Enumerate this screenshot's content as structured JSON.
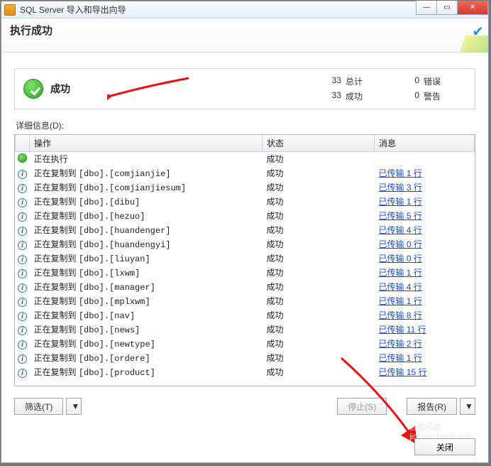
{
  "window": {
    "title": "SQL Server 导入和导出向导"
  },
  "header": {
    "title": "执行成功"
  },
  "summary": {
    "success_label": "成功",
    "total_value": "33",
    "total_label": "总计",
    "error_value": "0",
    "error_label": "错误",
    "success_value": "33",
    "success_label2": "成功",
    "warn_value": "0",
    "warn_label": "警告"
  },
  "details_label": "详细信息(D):",
  "columns": {
    "op": "操作",
    "status": "状态",
    "msg": "消息"
  },
  "rows": [
    {
      "icon": "exec",
      "op": "正在执行",
      "status": "成功",
      "msg": ""
    },
    {
      "icon": "info",
      "op": "正在复制到 [dbo].[comjianjie]",
      "status": "成功",
      "msg": "已传输 1 行"
    },
    {
      "icon": "info",
      "op": "正在复制到 [dbo].[comjianjiesum]",
      "status": "成功",
      "msg": "已传输 3 行"
    },
    {
      "icon": "info",
      "op": "正在复制到 [dbo].[dibu]",
      "status": "成功",
      "msg": "已传输 1 行"
    },
    {
      "icon": "info",
      "op": "正在复制到 [dbo].[hezuo]",
      "status": "成功",
      "msg": "已传输 5 行"
    },
    {
      "icon": "info",
      "op": "正在复制到 [dbo].[huandenger]",
      "status": "成功",
      "msg": "已传输 4 行"
    },
    {
      "icon": "info",
      "op": "正在复制到 [dbo].[huandengyi]",
      "status": "成功",
      "msg": "已传输 0 行"
    },
    {
      "icon": "info",
      "op": "正在复制到 [dbo].[liuyan]",
      "status": "成功",
      "msg": "已传输 0 行"
    },
    {
      "icon": "info",
      "op": "正在复制到 [dbo].[lxwm]",
      "status": "成功",
      "msg": "已传输 1 行"
    },
    {
      "icon": "info",
      "op": "正在复制到 [dbo].[manager]",
      "status": "成功",
      "msg": "已传输 4 行"
    },
    {
      "icon": "info",
      "op": "正在复制到 [dbo].[mplxwm]",
      "status": "成功",
      "msg": "已传输 1 行"
    },
    {
      "icon": "info",
      "op": "正在复制到 [dbo].[nav]",
      "status": "成功",
      "msg": "已传输 8 行"
    },
    {
      "icon": "info",
      "op": "正在复制到 [dbo].[news]",
      "status": "成功",
      "msg": "已传输 11 行"
    },
    {
      "icon": "info",
      "op": "正在复制到 [dbo].[newtype]",
      "status": "成功",
      "msg": "已传输 2 行"
    },
    {
      "icon": "info",
      "op": "正在复制到 [dbo].[ordere]",
      "status": "成功",
      "msg": "已传输 1 行"
    },
    {
      "icon": "info",
      "op": "正在复制到 [dbo].[product]",
      "status": "成功",
      "msg": "已传输 15 行"
    }
  ],
  "buttons": {
    "filter": "筛选(T)",
    "stop": "停止(S)",
    "report": "报告(R)",
    "close": "关闭"
  }
}
